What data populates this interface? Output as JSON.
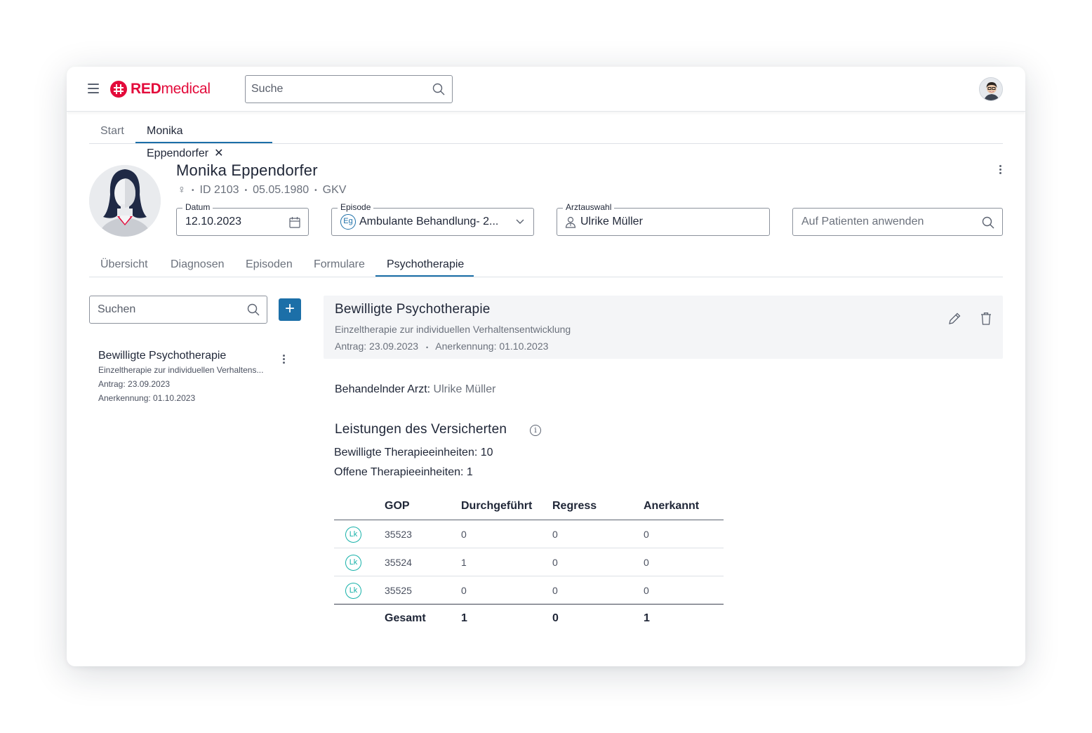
{
  "app": {
    "brand_part1": "RED",
    "brand_part2": "medical",
    "brand_color": "#e30b3b",
    "accent_color": "#1c6fa8",
    "search_placeholder": "Suche"
  },
  "tabs_top": [
    {
      "label": "Start"
    },
    {
      "label": "Monika Eppendorfer",
      "close": "✕"
    }
  ],
  "patient": {
    "name": "Monika Eppendorfer",
    "gender_icon": "♀",
    "id": "ID 2103",
    "birthdate": "05.05.1980",
    "insurance": "GKV"
  },
  "fields": {
    "datum_label": "Datum",
    "datum_value": "12.10.2023",
    "episode_label": "Episode",
    "episode_badge": "Eg",
    "episode_value": "Ambulante Behandlung- 2...",
    "arzt_label": "Arztauswahl",
    "arzt_value": "Ulrike Müller",
    "apply_placeholder": "Auf Patienten anwenden"
  },
  "tabs_sub": [
    {
      "label": "Übersicht"
    },
    {
      "label": "Diagnosen"
    },
    {
      "label": "Episoden"
    },
    {
      "label": "Formulare"
    },
    {
      "label": "Psychotherapie",
      "active": true
    }
  ],
  "left": {
    "search_placeholder": "Suchen",
    "add_label": "+",
    "item": {
      "title": "Bewilligte Psychotherapie",
      "subtitle": "Einzeltherapie zur individuellen Verhaltens...",
      "antrag": "Antrag: 23.09.2023",
      "anerkennung": "Anerkennung: 01.10.2023"
    }
  },
  "detail": {
    "title": "Bewilligte Psychotherapie",
    "subtitle": "Einzeltherapie zur individuellen Verhaltensentwicklung",
    "antrag": "Antrag: 23.09.2023",
    "anerkennung": "Anerkennung: 01.10.2023",
    "arzt_label": "Behandelnder Arzt:",
    "arzt_value": "Ulrike Müller",
    "section_title": "Leistungen des Versicherten",
    "bewilligt": "Bewilligte Therapieeinheiten: 10",
    "offen": "Offene Therapieeinheiten: 1"
  },
  "table": {
    "headers": [
      "GOP",
      "Durchgeführt",
      "Regress",
      "Anerkannt"
    ],
    "rows": [
      {
        "badge": "Lk",
        "gop": "35523",
        "durchgefuehrt": "0",
        "regress": "0",
        "anerkannt": "0"
      },
      {
        "badge": "Lk",
        "gop": "35524",
        "durchgefuehrt": "1",
        "regress": "0",
        "anerkannt": "0"
      },
      {
        "badge": "Lk",
        "gop": "35525",
        "durchgefuehrt": "0",
        "regress": "0",
        "anerkannt": "0"
      }
    ],
    "footer": {
      "label": "Gesamt",
      "durchgefuehrt": "1",
      "regress": "0",
      "anerkannt": "1"
    }
  }
}
